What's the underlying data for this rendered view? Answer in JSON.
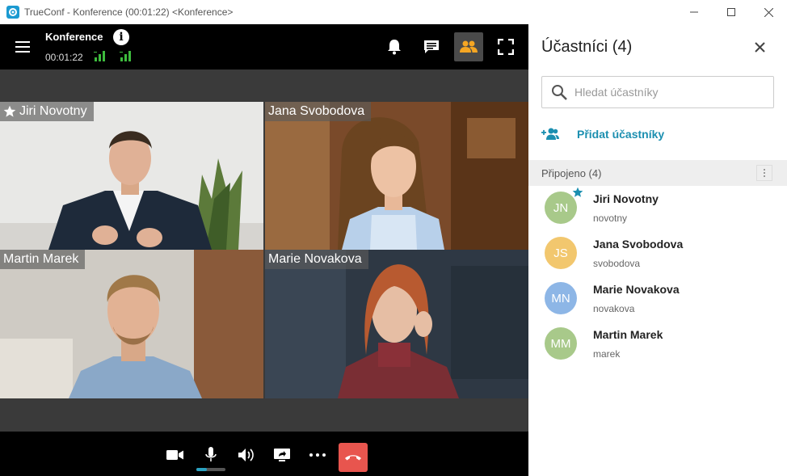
{
  "window": {
    "title": "TrueConf - Konference (00:01:22) <Konference>"
  },
  "conference": {
    "name": "Konference",
    "timer": "00:01:22"
  },
  "tiles": [
    {
      "name": "Jiri Novotny",
      "starred": true
    },
    {
      "name": "Jana Svobodova"
    },
    {
      "name": "Martin Marek"
    },
    {
      "name": "Marie Novakova"
    }
  ],
  "controls": {
    "mic_level": 0.35,
    "hangup_color": "#e8554e"
  },
  "panel": {
    "title": "Účastníci (4)",
    "search_placeholder": "Hledat účastníky",
    "add_label": "Přidat účastníky",
    "section_label": "Připojeno (4)",
    "participants": [
      {
        "initials": "JN",
        "name": "Jiri Novotny",
        "login": "novotny",
        "color": "#a8c98a",
        "owner": true
      },
      {
        "initials": "JS",
        "name": "Jana Svobodova",
        "login": "svobodova",
        "color": "#f2c76e"
      },
      {
        "initials": "MN",
        "name": "Marie Novakova",
        "login": "novakova",
        "color": "#8db6e6"
      },
      {
        "initials": "MM",
        "name": "Martin Marek",
        "login": "marek",
        "color": "#a8c98a"
      }
    ]
  },
  "colors": {
    "accent": "#1b8fb0",
    "signal_green": "#3dbb3d",
    "active_button": "#f5a623"
  }
}
